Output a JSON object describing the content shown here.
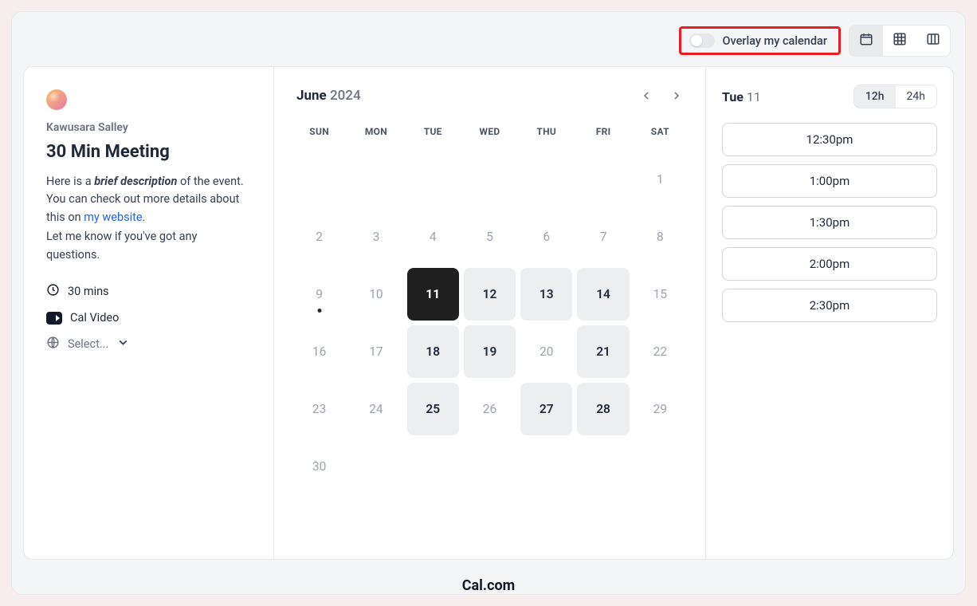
{
  "topbar": {
    "overlay_label": "Overlay my calendar",
    "views": [
      "month",
      "grid",
      "columns"
    ]
  },
  "event": {
    "host": "Kawusara Salley",
    "title": "30 Min Meeting",
    "desc_pre": "Here is a ",
    "desc_emph": "brief description",
    "desc_mid": " of the event. You can check out more details about this on ",
    "desc_link": "my website",
    "desc_post": ".",
    "desc_line2": "Let me know if you've got any questions.",
    "duration": "30 mins",
    "location": "Cal Video",
    "timezone_label": "Select..."
  },
  "calendar": {
    "month": "June",
    "year": "2024",
    "dow": [
      "SUN",
      "MON",
      "TUE",
      "WED",
      "THU",
      "FRI",
      "SAT"
    ],
    "cells": [
      {
        "n": "",
        "t": "empty"
      },
      {
        "n": "",
        "t": "empty"
      },
      {
        "n": "",
        "t": "empty"
      },
      {
        "n": "",
        "t": "empty"
      },
      {
        "n": "",
        "t": "empty"
      },
      {
        "n": "",
        "t": "empty"
      },
      {
        "n": "1",
        "t": "dim"
      },
      {
        "n": "2",
        "t": "dim"
      },
      {
        "n": "3",
        "t": "dim"
      },
      {
        "n": "4",
        "t": "dim"
      },
      {
        "n": "5",
        "t": "dim"
      },
      {
        "n": "6",
        "t": "dim"
      },
      {
        "n": "7",
        "t": "dim"
      },
      {
        "n": "8",
        "t": "dim"
      },
      {
        "n": "9",
        "t": "dim",
        "dot": true
      },
      {
        "n": "10",
        "t": "dim"
      },
      {
        "n": "11",
        "t": "sel"
      },
      {
        "n": "12",
        "t": "avail"
      },
      {
        "n": "13",
        "t": "avail"
      },
      {
        "n": "14",
        "t": "avail"
      },
      {
        "n": "15",
        "t": "dim"
      },
      {
        "n": "16",
        "t": "dim"
      },
      {
        "n": "17",
        "t": "dim"
      },
      {
        "n": "18",
        "t": "avail"
      },
      {
        "n": "19",
        "t": "avail"
      },
      {
        "n": "20",
        "t": "dim"
      },
      {
        "n": "21",
        "t": "avail"
      },
      {
        "n": "22",
        "t": "dim"
      },
      {
        "n": "23",
        "t": "dim"
      },
      {
        "n": "24",
        "t": "dim"
      },
      {
        "n": "25",
        "t": "avail"
      },
      {
        "n": "26",
        "t": "dim"
      },
      {
        "n": "27",
        "t": "avail"
      },
      {
        "n": "28",
        "t": "avail"
      },
      {
        "n": "29",
        "t": "dim"
      },
      {
        "n": "30",
        "t": "dim"
      }
    ]
  },
  "slots": {
    "day_name": "Tue",
    "day_num": "11",
    "fmt_12": "12h",
    "fmt_24": "24h",
    "times": [
      "12:30pm",
      "1:00pm",
      "1:30pm",
      "2:00pm",
      "2:30pm"
    ]
  },
  "footer": {
    "brand": "Cal.com"
  }
}
